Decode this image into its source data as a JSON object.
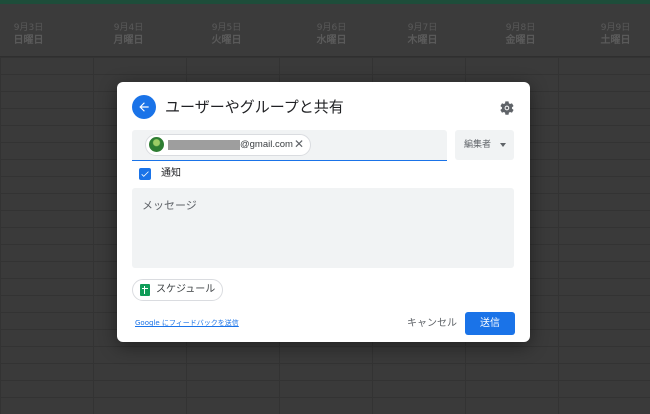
{
  "calendar": {
    "columns": [
      {
        "date": "9月3日",
        "weekday": "日曜日"
      },
      {
        "date": "9月4日",
        "weekday": "月曜日"
      },
      {
        "date": "9月5日",
        "weekday": "火曜日"
      },
      {
        "date": "9月6日",
        "weekday": "水曜日"
      },
      {
        "date": "9月7日",
        "weekday": "木曜日"
      },
      {
        "date": "9月8日",
        "weekday": "金曜日"
      },
      {
        "date": "9月9日",
        "weekday": "土曜日"
      }
    ]
  },
  "dialog": {
    "title": "ユーザーやグループと共有",
    "back_icon": "arrow-left-icon",
    "settings_icon": "gear-icon",
    "recipient": {
      "email_visible": "@gmail.com",
      "remove_symbol": "✕"
    },
    "role": {
      "label": "編集者"
    },
    "notify": {
      "label": "通知",
      "checked": true
    },
    "message": {
      "placeholder": "メッセージ"
    },
    "attachment": {
      "label": "スケジュール",
      "icon": "sheets-icon"
    },
    "feedback_link": "Google にフィードバックを送信",
    "cancel_label": "キャンセル",
    "send_label": "送信"
  },
  "colors": {
    "accent": "#1a73e8",
    "sheets_green": "#0f9d58",
    "overlay": "#3a3a3a"
  }
}
